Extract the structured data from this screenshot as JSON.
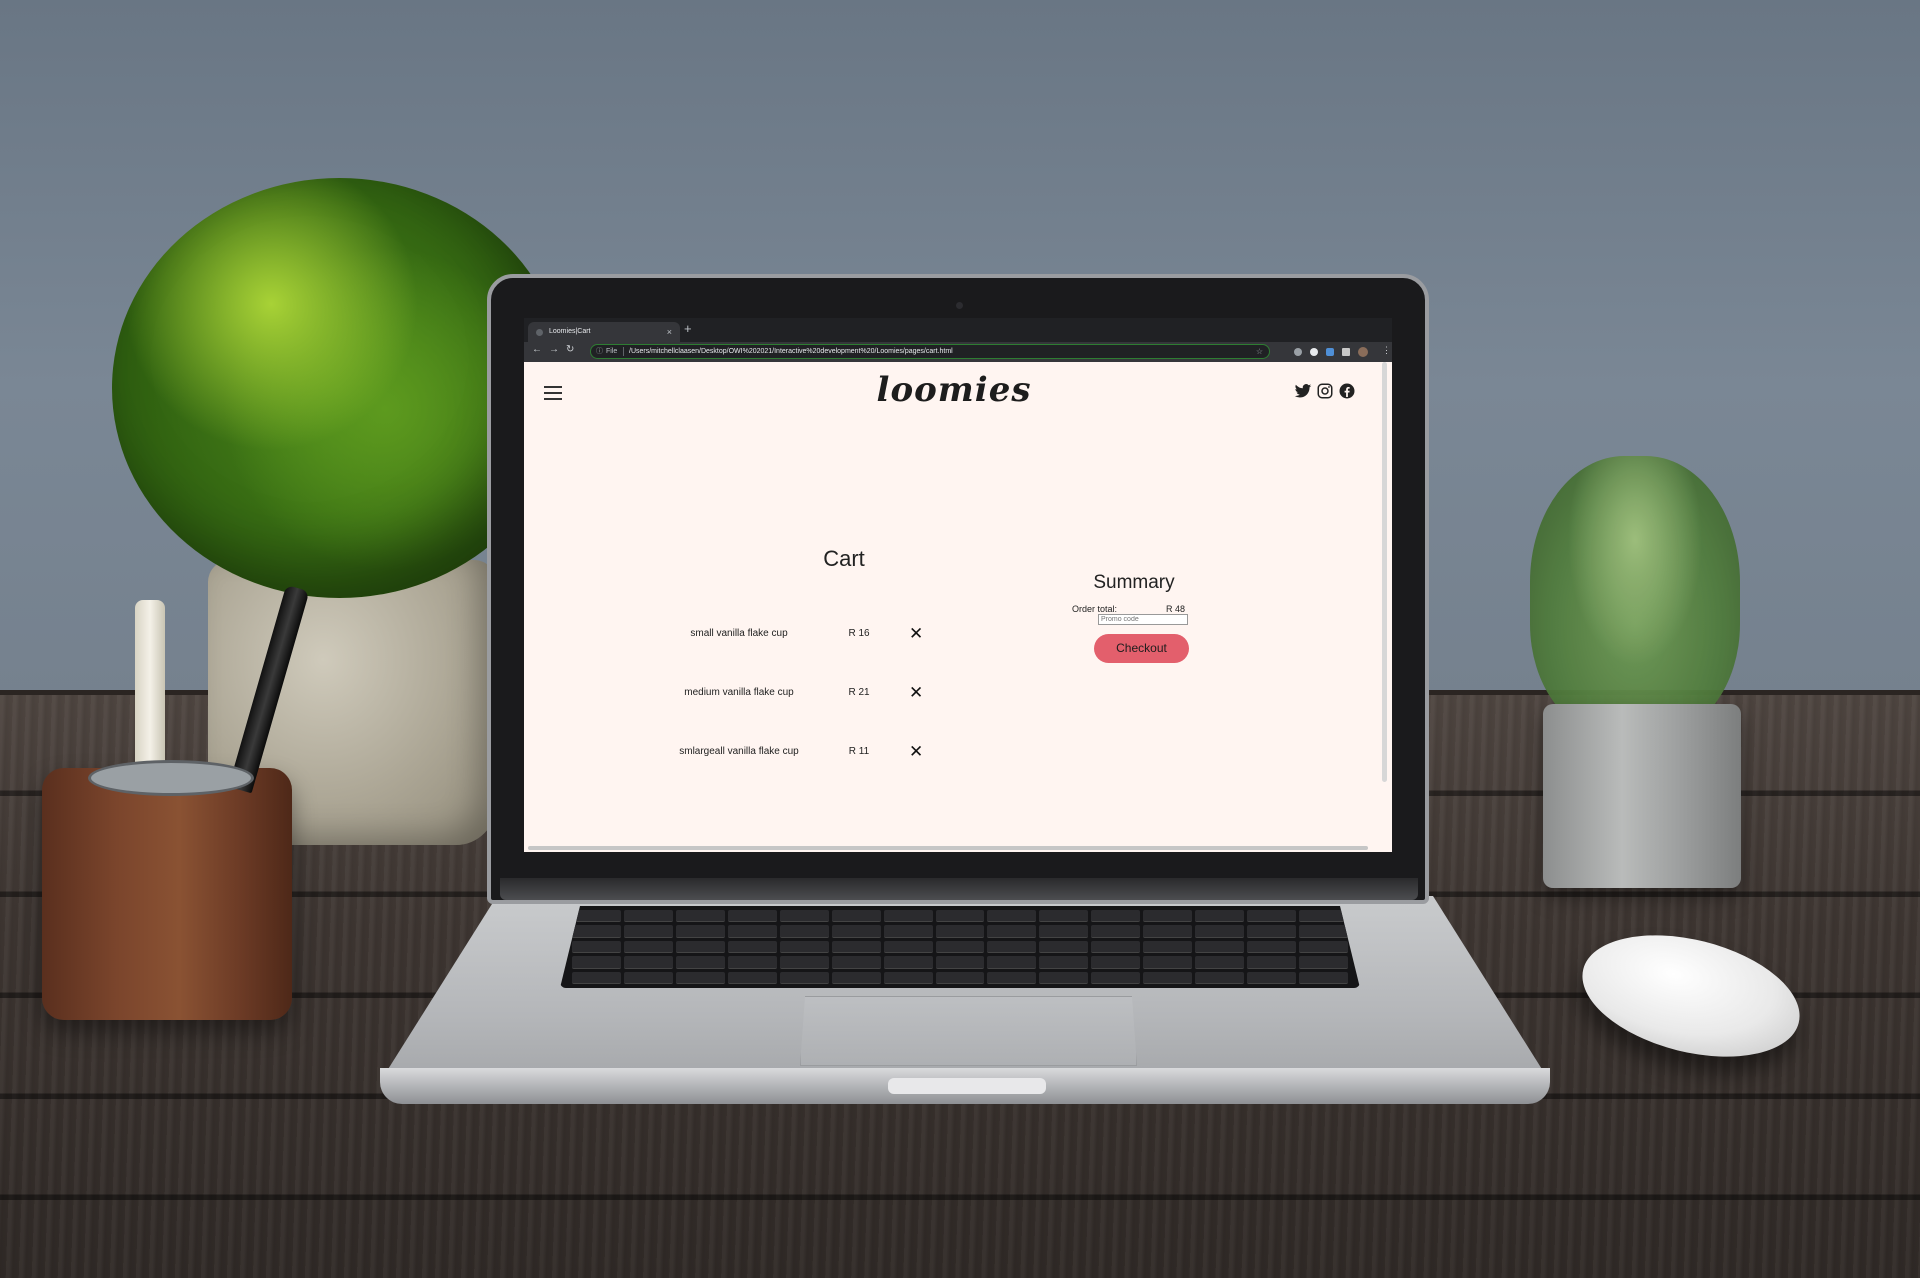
{
  "browser": {
    "tab_title": "Loomies|Cart",
    "tab_close": "×",
    "new_tab": "+",
    "back": "←",
    "forward": "→",
    "reload": "↻",
    "info_icon": "ⓘ",
    "scheme": "File",
    "url": "/Users/mitchellclaasen/Desktop/OWI%202021/Interactive%20development%20/Loomies/pages/cart.html",
    "star": "☆",
    "menu": "⋮"
  },
  "header": {
    "logo": "loomies",
    "socials": [
      "twitter-icon",
      "instagram-icon",
      "facebook-icon"
    ]
  },
  "cart": {
    "title": "Cart",
    "items": [
      {
        "name": "small vanilla flake cup",
        "price": "R 16",
        "remove": "✕"
      },
      {
        "name": "medium vanilla flake cup",
        "price": "R 21",
        "remove": "✕"
      },
      {
        "name": "smlargeall vanilla flake cup",
        "price": "R 11",
        "remove": "✕"
      }
    ]
  },
  "summary": {
    "title": "Summary",
    "order_total_label": "Order total:",
    "order_total_value": "R 48",
    "promo_placeholder": "Promo code",
    "checkout_label": "Checkout"
  },
  "colors": {
    "page_bg": "#fff5f1",
    "checkout": "#e35f6c",
    "browser_dark": "#202124"
  }
}
